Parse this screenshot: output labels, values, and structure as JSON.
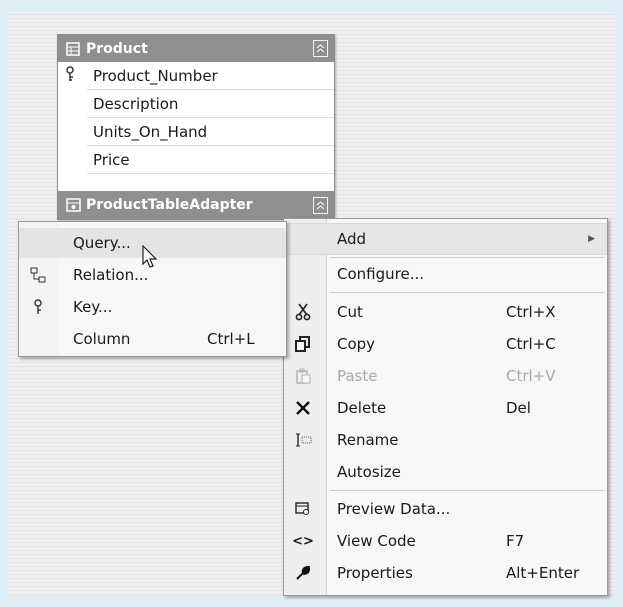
{
  "table": {
    "title": "Product",
    "columns": [
      "Product_Number",
      "Description",
      "Units_On_Hand",
      "Price"
    ],
    "key_column_icon": "key-icon",
    "adapter_title": "ProductTableAdapter"
  },
  "context_menu": {
    "items": [
      {
        "label": "Add",
        "shortcut": "",
        "icon": "",
        "submenu": true
      },
      {
        "label": "Configure...",
        "shortcut": "",
        "icon": ""
      },
      {
        "label": "Cut",
        "shortcut": "Ctrl+X",
        "icon": "scissors-icon"
      },
      {
        "label": "Copy",
        "shortcut": "Ctrl+C",
        "icon": "copy-icon"
      },
      {
        "label": "Paste",
        "shortcut": "Ctrl+V",
        "icon": "paste-icon",
        "disabled": true
      },
      {
        "label": "Delete",
        "shortcut": "Del",
        "icon": "delete-x-icon"
      },
      {
        "label": "Rename",
        "shortcut": "",
        "icon": "rename-icon"
      },
      {
        "label": "Autosize",
        "shortcut": "",
        "icon": ""
      },
      {
        "label": "Preview Data...",
        "shortcut": "",
        "icon": "preview-data-icon"
      },
      {
        "label": "View Code",
        "shortcut": "F7",
        "icon": "view-code-icon"
      },
      {
        "label": "Properties",
        "shortcut": "Alt+Enter",
        "icon": "wrench-icon"
      }
    ]
  },
  "add_submenu": {
    "items": [
      {
        "label": "Query...",
        "shortcut": "",
        "icon": ""
      },
      {
        "label": "Relation...",
        "shortcut": "",
        "icon": "relation-icon"
      },
      {
        "label": "Key...",
        "shortcut": "",
        "icon": "key-icon"
      },
      {
        "label": "Column",
        "shortcut": "Ctrl+L",
        "icon": ""
      }
    ]
  },
  "colors": {
    "header": "#8f8f8f",
    "menu_bg": "#f7f7f7",
    "hover": "#e6e6e6"
  }
}
